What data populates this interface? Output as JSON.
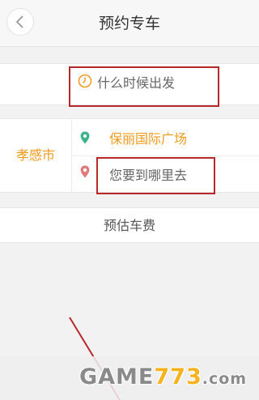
{
  "header": {
    "title": "预约专车"
  },
  "time_row": {
    "placeholder": "什么时候出发"
  },
  "route": {
    "city": "孝感市",
    "from": "保丽国际广场",
    "to_placeholder": "您要到哪里去"
  },
  "estimate": {
    "label": "预估车费"
  },
  "watermark": {
    "prefix": "GAME",
    "number": "773",
    "suffix": ".com"
  },
  "colors": {
    "accent": "#f19a1c",
    "from_pin": "#3bb389",
    "to_pin": "#e07a7a",
    "highlight": "#b8282a"
  }
}
